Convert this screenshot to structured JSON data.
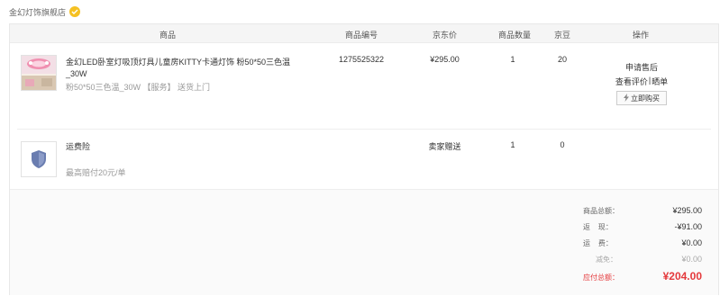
{
  "shop": {
    "name": "金幻灯饰旗舰店"
  },
  "table": {
    "headers": {
      "product": "商品",
      "sku": "商品编号",
      "price": "京东价",
      "qty": "商品数量",
      "beans": "京豆",
      "action": "操作"
    }
  },
  "item": {
    "title_line1": "金幻LED卧室灯吸顶灯具儿童房KITTY卡通灯饰 粉50*50三色温",
    "title_line2": "_30W",
    "sub": "粉50*50三色温_30W 【服务】 送货上门",
    "sku": "1275525322",
    "price": "¥295.00",
    "qty": "1",
    "beans": "20",
    "actions": {
      "after_sale": "申请售后",
      "review": "查看评价",
      "separator": "|",
      "share": "晒单",
      "buy_again": "立即购买"
    }
  },
  "insurance": {
    "title": "运费险",
    "sub": "最高赔付20元/单",
    "price": "卖家赠送",
    "qty": "1",
    "beans": "0"
  },
  "summary": {
    "goods_label": "商品总额：",
    "goods_value": "¥295.00",
    "rebate_label": "返    现：",
    "rebate_value": "-¥91.00",
    "freight_label": "运    费：",
    "freight_value": "¥0.00",
    "fourth_label": "减免：",
    "fourth_value": "¥0.00",
    "total_label": "应付总额：",
    "total_value": "¥204.00"
  },
  "colors": {
    "accent": "#e4393c",
    "badge": "#f5c122",
    "shield": "#6a7db0"
  }
}
